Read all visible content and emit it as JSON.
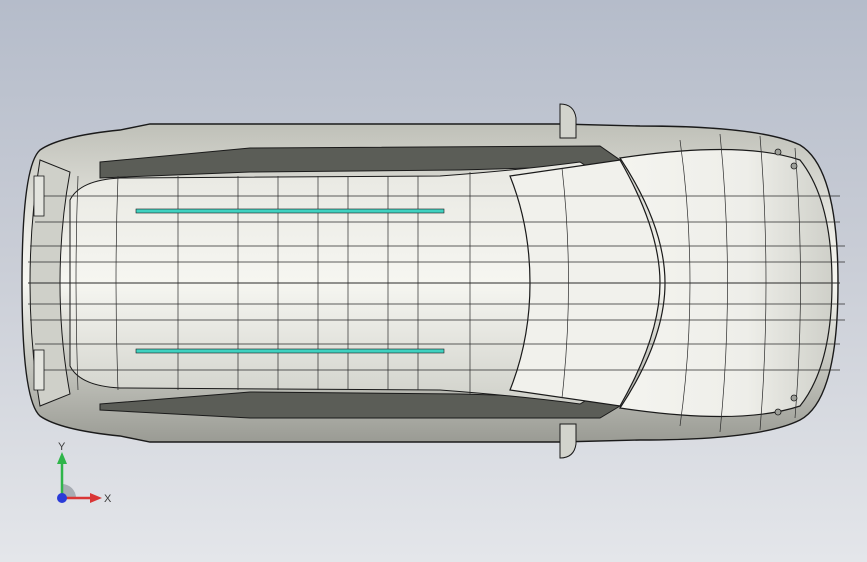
{
  "view": {
    "model": "car-top-view",
    "background_top": "#b5bcca",
    "background_bottom": "#e4e6ea",
    "body_color": "#d9dad4",
    "edge_color": "#1a1a1a",
    "roof_rail_color": "#3fd1c0"
  },
  "triad": {
    "y_label": "Y",
    "x_label": "X",
    "y_color": "#2fb54a",
    "x_color": "#d93636",
    "z_color": "#2a3bd8"
  }
}
